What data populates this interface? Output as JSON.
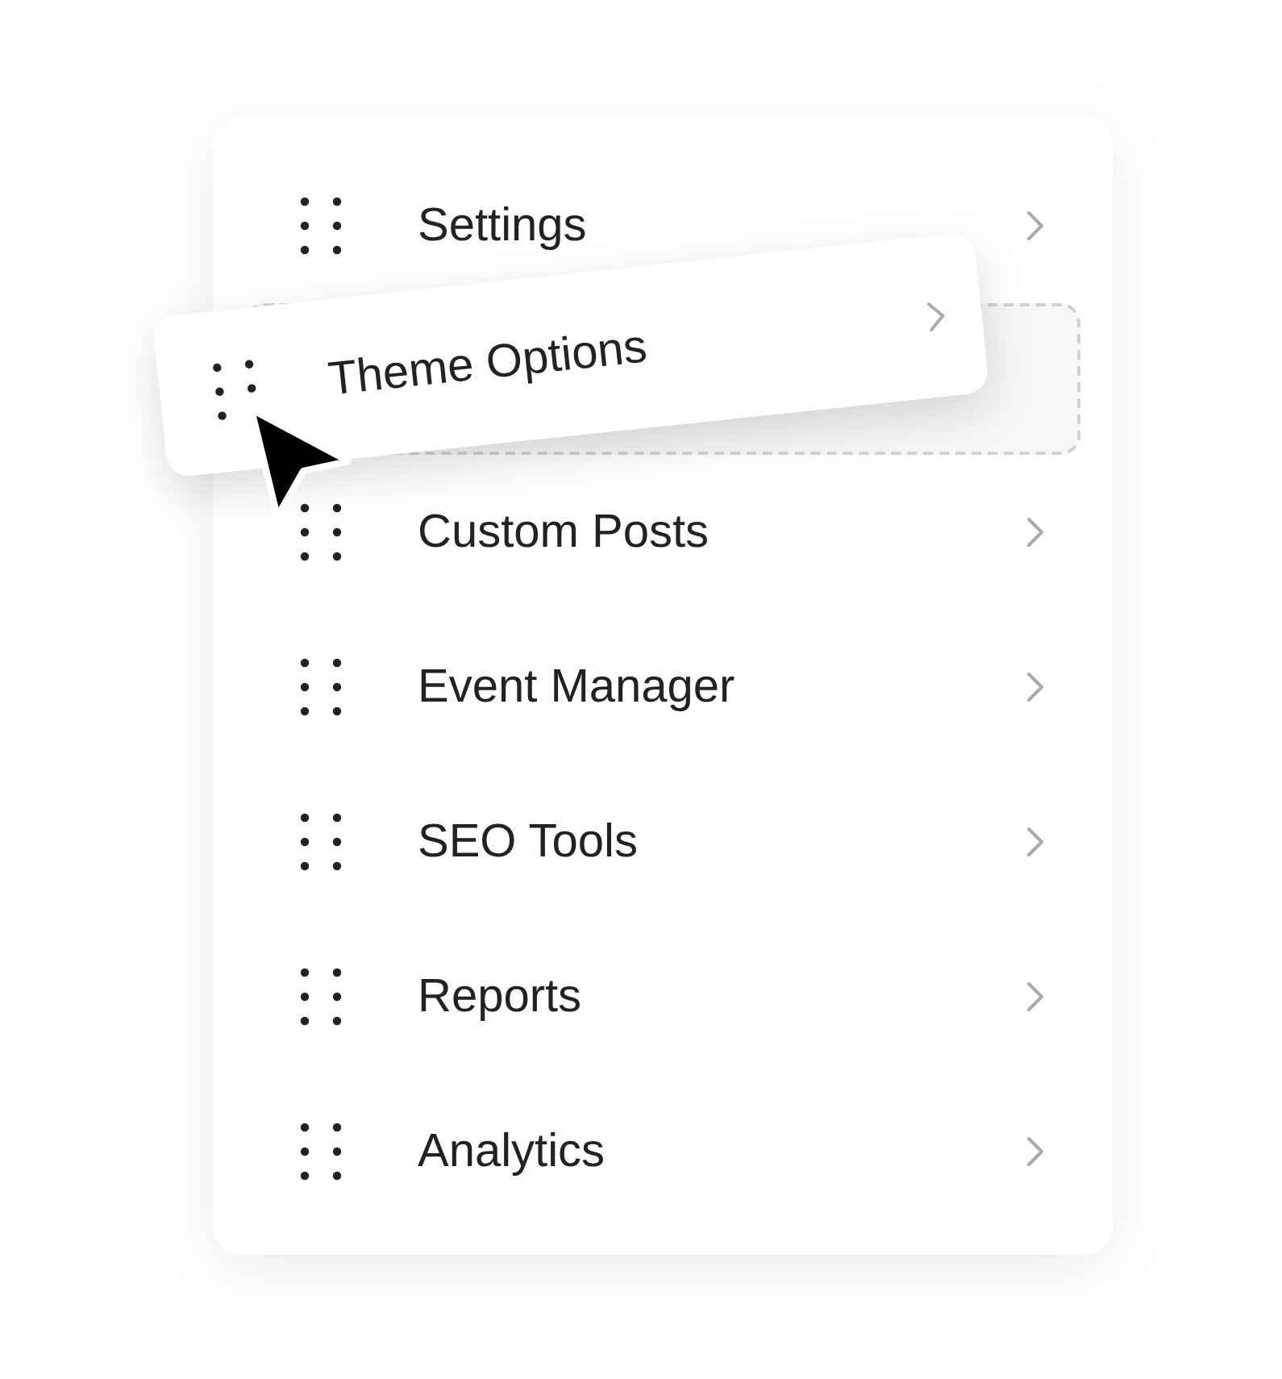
{
  "menu": {
    "items": [
      {
        "kind": "item",
        "label": "Settings"
      },
      {
        "kind": "placeholder"
      },
      {
        "kind": "item",
        "label": "Custom Posts"
      },
      {
        "kind": "item",
        "label": "Event Manager"
      },
      {
        "kind": "item",
        "label": "SEO Tools"
      },
      {
        "kind": "item",
        "label": "Reports"
      },
      {
        "kind": "item",
        "label": "Analytics"
      }
    ]
  },
  "dragged_item": {
    "label": "Theme Options"
  }
}
